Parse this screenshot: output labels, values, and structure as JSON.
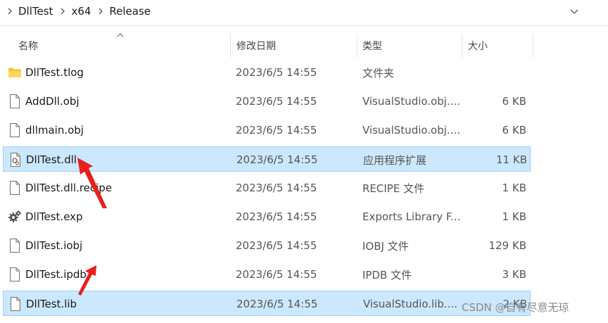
{
  "breadcrumb": {
    "items": [
      "DllTest",
      "x64",
      "Release"
    ]
  },
  "columns": {
    "name": "名称",
    "date": "修改日期",
    "type": "类型",
    "size": "大小"
  },
  "files": [
    {
      "name": "DllTest.tlog",
      "date": "2023/6/5 14:55",
      "type": "文件夹",
      "size": "",
      "icon": "folder-icon",
      "selected": false
    },
    {
      "name": "AddDll.obj",
      "date": "2023/6/5 14:55",
      "type": "VisualStudio.obj....",
      "size": "6 KB",
      "icon": "file-icon",
      "selected": false
    },
    {
      "name": "dllmain.obj",
      "date": "2023/6/5 14:55",
      "type": "VisualStudio.obj....",
      "size": "6 KB",
      "icon": "file-icon",
      "selected": false
    },
    {
      "name": "DllTest.dll",
      "date": "2023/6/5 14:55",
      "type": "应用程序扩展",
      "size": "11 KB",
      "icon": "dll-gear-file-icon",
      "selected": true
    },
    {
      "name": "DllTest.dll.recipe",
      "date": "2023/6/5 14:55",
      "type": "RECIPE 文件",
      "size": "1 KB",
      "icon": "file-icon",
      "selected": false
    },
    {
      "name": "DllTest.exp",
      "date": "2023/6/5 14:55",
      "type": "Exports Library F...",
      "size": "1 KB",
      "icon": "gears-icon",
      "selected": false
    },
    {
      "name": "DllTest.iobj",
      "date": "2023/6/5 14:55",
      "type": "IOBJ 文件",
      "size": "129 KB",
      "icon": "file-icon",
      "selected": false
    },
    {
      "name": "DllTest.ipdb",
      "date": "2023/6/5 14:55",
      "type": "IPDB 文件",
      "size": "3 KB",
      "icon": "file-icon",
      "selected": false
    },
    {
      "name": "DllTest.lib",
      "date": "2023/6/5 14:55",
      "type": "VisualStudio.lib....",
      "size": "2 KB",
      "icon": "file-icon",
      "selected": true
    }
  ],
  "watermark": "CSDN @自有尽意无琼",
  "colors": {
    "selection": "#cce8ff",
    "selection_border": "#99d1ff",
    "folder": "#f8c13a",
    "arrow": "#e8201c"
  }
}
